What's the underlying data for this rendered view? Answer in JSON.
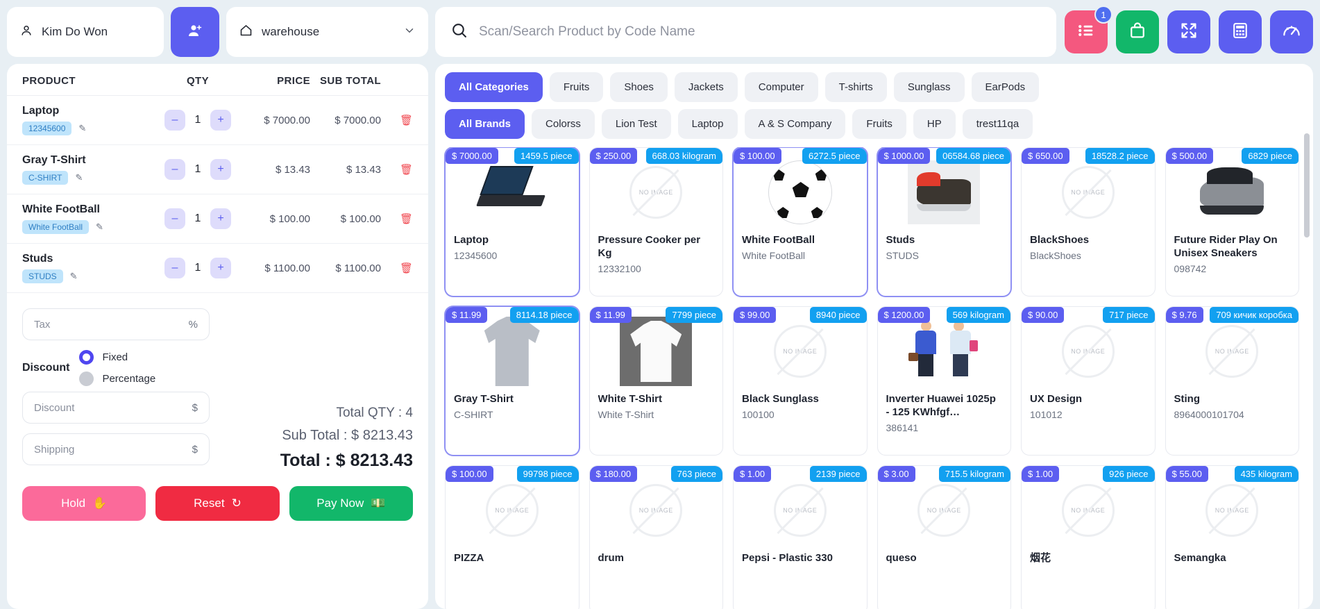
{
  "customer": {
    "name": "Kim Do Won",
    "icon": "user-icon",
    "add_icon": "user-plus-icon"
  },
  "warehouse": {
    "value": "warehouse",
    "icon": "home-icon",
    "chevron": "chevron-down-icon"
  },
  "search": {
    "placeholder": "Scan/Search Product by Code Name",
    "value": "",
    "icon": "search-icon"
  },
  "toolbar": [
    {
      "name": "orders-list-button",
      "icon": "list-icon",
      "color": "#f4587f",
      "badge": "1"
    },
    {
      "name": "shopping-bag-button",
      "icon": "shopping-bag-icon",
      "color": "#12b76a",
      "badge": ""
    },
    {
      "name": "fullscreen-button",
      "icon": "fullscreen-icon",
      "color": "#5c5ef0",
      "badge": ""
    },
    {
      "name": "calculator-button",
      "icon": "calculator-icon",
      "color": "#5c5ef0",
      "badge": ""
    },
    {
      "name": "dashboard-button",
      "icon": "gauge-icon",
      "color": "#5c5ef0",
      "badge": ""
    }
  ],
  "cart": {
    "columns": {
      "product": "PRODUCT",
      "qty": "QTY",
      "price": "PRICE",
      "subtotal": "SUB TOTAL"
    },
    "rows": [
      {
        "name": "Laptop",
        "code": "12345600",
        "qty": "1",
        "price": "$ 7000.00",
        "subtotal": "$ 7000.00"
      },
      {
        "name": "Gray T-Shirt",
        "code": "C-SHIRT",
        "qty": "1",
        "price": "$ 13.43",
        "subtotal": "$ 13.43"
      },
      {
        "name": "White FootBall",
        "code": "White FootBall",
        "qty": "1",
        "price": "$ 100.00",
        "subtotal": "$ 100.00"
      },
      {
        "name": "Studs",
        "code": "STUDS",
        "qty": "1",
        "price": "$ 1100.00",
        "subtotal": "$ 1100.00"
      }
    ],
    "minus": "–",
    "plus": "+"
  },
  "form": {
    "tax_placeholder": "Tax",
    "tax_value": "",
    "tax_suffix": "%",
    "discount_label": "Discount",
    "discount_fixed": "Fixed",
    "discount_percentage": "Percentage",
    "discount_selected": "Fixed",
    "discount_placeholder": "Discount",
    "discount_value": "",
    "discount_suffix": "$",
    "shipping_placeholder": "Shipping",
    "shipping_value": "",
    "shipping_suffix": "$"
  },
  "summary": {
    "total_qty": "Total QTY : 4",
    "sub_total": "Sub Total : $ 8213.43",
    "total": "Total : $ 8213.43"
  },
  "actions": {
    "hold": "Hold",
    "hold_icon": "✋",
    "reset": "Reset",
    "reset_icon": "↻",
    "pay": "Pay Now",
    "pay_icon": "💵"
  },
  "categories": [
    {
      "label": "All Categories",
      "active": true
    },
    {
      "label": "Fruits",
      "active": false
    },
    {
      "label": "Shoes",
      "active": false
    },
    {
      "label": "Jackets",
      "active": false
    },
    {
      "label": "Computer",
      "active": false
    },
    {
      "label": "T-shirts",
      "active": false
    },
    {
      "label": "Sunglass",
      "active": false
    },
    {
      "label": "EarPods",
      "active": false
    }
  ],
  "brands": [
    {
      "label": "All Brands",
      "active": true
    },
    {
      "label": "Colorss",
      "active": false
    },
    {
      "label": "Lion Test",
      "active": false
    },
    {
      "label": "Laptop",
      "active": false
    },
    {
      "label": "A & S Company",
      "active": false
    },
    {
      "label": "Fruits",
      "active": false
    },
    {
      "label": "HP",
      "active": false
    },
    {
      "label": "trest11qa",
      "active": false
    }
  ],
  "no_image_text": "NO IMAGE",
  "products": [
    {
      "price": "$ 7000.00",
      "stock": "1459.5 piece",
      "name": "Laptop",
      "code": "12345600",
      "image": "laptop",
      "selected": true
    },
    {
      "price": "$ 250.00",
      "stock": "668.03 kilogram",
      "name": "Pressure Cooker per Kg",
      "code": "12332100",
      "image": "none",
      "selected": false
    },
    {
      "price": "$ 100.00",
      "stock": "6272.5 piece",
      "name": "White FootBall",
      "code": "White FootBall",
      "image": "football",
      "selected": true
    },
    {
      "price": "$ 1000.00",
      "stock": "06584.68 piece",
      "name": "Studs",
      "code": "STUDS",
      "image": "cleat",
      "selected": true
    },
    {
      "price": "$ 650.00",
      "stock": "18528.2 piece",
      "name": "BlackShoes",
      "code": "BlackShoes",
      "image": "none",
      "selected": false
    },
    {
      "price": "$ 500.00",
      "stock": "6829 piece",
      "name": "Future Rider Play On Unisex Sneakers",
      "code": "098742",
      "image": "sneaker",
      "selected": false
    },
    {
      "price": "$ 11.99",
      "stock": "8114.18 piece",
      "name": "Gray T-Shirt",
      "code": "C-SHIRT",
      "image": "polo",
      "selected": true
    },
    {
      "price": "$ 11.99",
      "stock": "7799 piece",
      "name": "White T-Shirt",
      "code": "White T-Shirt",
      "image": "tee",
      "selected": false
    },
    {
      "price": "$ 99.00",
      "stock": "8940 piece",
      "name": "Black Sunglass",
      "code": "100100",
      "image": "none",
      "selected": false
    },
    {
      "price": "$ 1200.00",
      "stock": "569 kilogram",
      "name": "Inverter Huawei 1025p - 125 KWhfgf…",
      "code": "386141",
      "image": "people",
      "selected": false
    },
    {
      "price": "$ 90.00",
      "stock": "717 piece",
      "name": "UX Design",
      "code": "101012",
      "image": "none",
      "selected": false
    },
    {
      "price": "$ 9.76",
      "stock": "709 кичик коробка",
      "name": "Sting",
      "code": "8964000101704",
      "image": "none",
      "selected": false
    },
    {
      "price": "$ 100.00",
      "stock": "99798 piece",
      "name": "PIZZA",
      "code": "",
      "image": "none",
      "selected": false
    },
    {
      "price": "$ 180.00",
      "stock": "763 piece",
      "name": "drum",
      "code": "",
      "image": "none",
      "selected": false
    },
    {
      "price": "$ 1.00",
      "stock": "2139 piece",
      "name": "Pepsi - Plastic 330",
      "code": "",
      "image": "none",
      "selected": false
    },
    {
      "price": "$ 3.00",
      "stock": "715.5 kilogram",
      "name": "queso",
      "code": "",
      "image": "none",
      "selected": false
    },
    {
      "price": "$ 1.00",
      "stock": "926 piece",
      "name": "烟花",
      "code": "",
      "image": "none",
      "selected": false
    },
    {
      "price": "$ 55.00",
      "stock": "435 kilogram",
      "name": "Semangka",
      "code": "",
      "image": "none",
      "selected": false
    }
  ]
}
